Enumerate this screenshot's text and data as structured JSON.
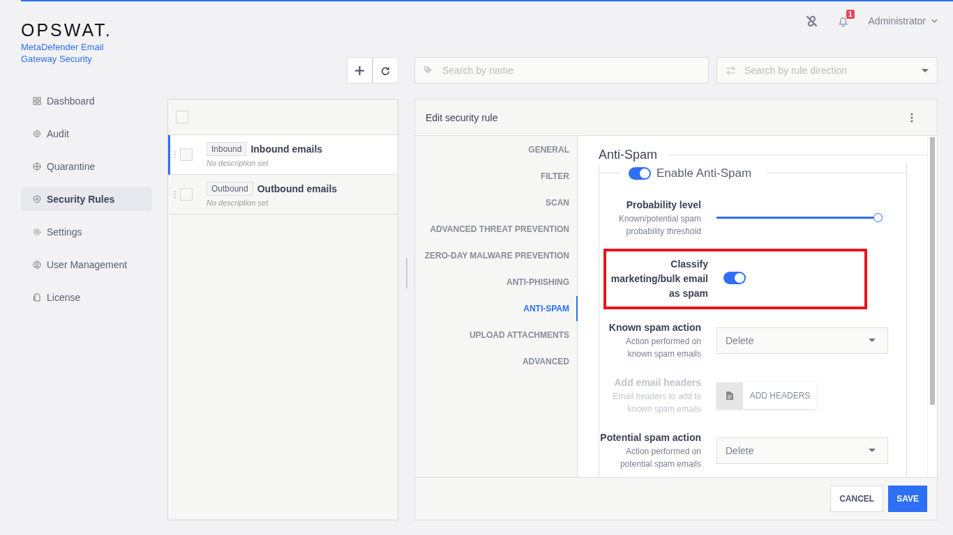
{
  "logo": {
    "brand": "OPSWAT.",
    "product": "MetaDefender Email Gateway Security"
  },
  "header": {
    "notifications": "1",
    "user": "Administrator"
  },
  "sidebar": {
    "items": [
      {
        "label": "Dashboard",
        "selected": false
      },
      {
        "label": "Audit",
        "selected": false
      },
      {
        "label": "Quarantine",
        "selected": false
      },
      {
        "label": "Security Rules",
        "selected": true
      },
      {
        "label": "Settings",
        "selected": false
      },
      {
        "label": "User Management",
        "selected": false
      },
      {
        "label": "License",
        "selected": false
      }
    ]
  },
  "search": {
    "name_placeholder": "Search by name",
    "direction_placeholder": "Search by rule direction"
  },
  "select_all": {
    "checked": false
  },
  "rules": [
    {
      "tag": "Inbound",
      "name": "Inbound emails",
      "description": "No description set",
      "selected": true,
      "checked": false
    },
    {
      "tag": "Outbound",
      "name": "Outbound emails",
      "description": "No description set",
      "selected": false,
      "checked": false
    }
  ],
  "editor": {
    "title": "Edit security rule",
    "tabs": [
      {
        "label": "GENERAL",
        "selected": false
      },
      {
        "label": "FILTER",
        "selected": false
      },
      {
        "label": "SCAN",
        "selected": false
      },
      {
        "label": "ADVANCED THREAT PREVENTION",
        "selected": false
      },
      {
        "label": "ZERO-DAY MALWARE PREVENTION",
        "selected": false
      },
      {
        "label": "ANTI-PHISHING",
        "selected": false
      },
      {
        "label": "ANTI-SPAM",
        "selected": true
      },
      {
        "label": "UPLOAD ATTACHMENTS",
        "selected": false
      },
      {
        "label": "ADVANCED",
        "selected": false
      }
    ],
    "section_title": "Anti-Spam",
    "enable": {
      "label": "Enable Anti-Spam",
      "on": true
    },
    "settings": [
      {
        "kind": "slider",
        "label": "Probability level",
        "hint": "Known/potential spam probability threshold",
        "level": 1
      },
      {
        "kind": "toggle",
        "label": "Classify marketing/bulk email as spam",
        "on": true,
        "highlighted": true
      },
      {
        "kind": "select",
        "label": "Known spam action",
        "hint": "Action performed on known spam emails",
        "value": "Delete"
      },
      {
        "kind": "button",
        "label": "Add email headers",
        "hint": "Email headers to add to known spam emails",
        "disabled": true,
        "button": "ADD HEADERS"
      },
      {
        "kind": "select",
        "label": "Potential spam action",
        "hint": "Action performed on potential spam emails",
        "value": "Delete"
      }
    ],
    "buttons": {
      "cancel": "CANCEL",
      "save": "SAVE"
    }
  }
}
